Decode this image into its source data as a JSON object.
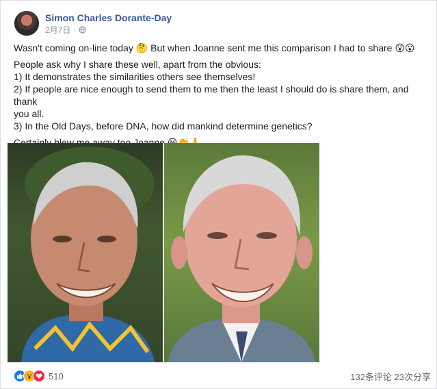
{
  "post": {
    "author": "Simon Charles Dorante-Day",
    "date": "2月7日",
    "separator": "·",
    "privacy_icon": "globe-icon",
    "paragraphs": {
      "p1": "Wasn't coming on-line today 🤔 But when Joanne sent me this comparison I had to share 😲😮",
      "p2_lines": [
        "People ask why I share these well, apart from the obvious:",
        "1) It demonstrates the similarities others see themselves!",
        "2) If people are nice enough to send them to me then the least I should do is share them, and thank",
        "you all.",
        "3) In the Old Days, before DNA, how did mankind determine genetics?"
      ],
      "p3": "Certainly blew me away too Joanne 😀👏🙏"
    }
  },
  "footer": {
    "reaction_icons": [
      "like-icon",
      "wow-icon",
      "love-icon"
    ],
    "reaction_count": "510",
    "stats": "132条评论 23次分享"
  },
  "colors": {
    "author": "#385898",
    "text": "#1c1e21",
    "meta": "#90949c",
    "like": "#1877f2",
    "wow": "#f7b125",
    "love": "#f0284a"
  }
}
